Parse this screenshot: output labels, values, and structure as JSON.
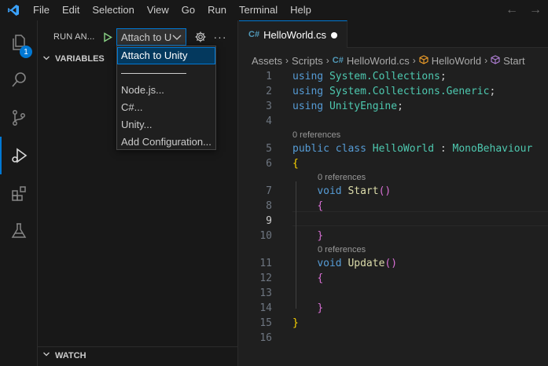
{
  "menu": {
    "items": [
      "File",
      "Edit",
      "Selection",
      "View",
      "Go",
      "Run",
      "Terminal",
      "Help"
    ]
  },
  "activity": {
    "explorer_badge": "1",
    "icons": [
      "files-icon",
      "search-icon",
      "source-control-icon",
      "run-debug-icon",
      "extensions-icon",
      "testing-icon"
    ]
  },
  "sidebar": {
    "run_label": "RUN AN...",
    "config_value": "Attach to Unity",
    "variables_label": "VARIABLES",
    "watch_label": "WATCH"
  },
  "dropdown": {
    "items": [
      "Attach to Unity",
      "Node.js...",
      "C#...",
      "Unity...",
      "Add Configuration..."
    ],
    "separator_text": "────────────"
  },
  "editor": {
    "tab_label": "HelloWorld.cs",
    "breadcrumbs": [
      "Assets",
      "Scripts",
      "HelloWorld.cs",
      "HelloWorld",
      "Start"
    ],
    "codelens": "0 references",
    "lines": [
      "using System.Collections;",
      "using System.Collections.Generic;",
      "using UnityEngine;",
      "",
      "public class HelloWorld : MonoBehaviour",
      "{",
      "    void Start()",
      "    {",
      "",
      "    }",
      "    void Update()",
      "    {",
      "",
      "    }",
      "}",
      ""
    ],
    "line_numbers": [
      "1",
      "2",
      "3",
      "4",
      "5",
      "6",
      "7",
      "8",
      "9",
      "10",
      "11",
      "12",
      "13",
      "14",
      "15",
      "16"
    ],
    "current_line": 9
  },
  "colors": {
    "accent": "#0078d4",
    "keyword": "#569cd6",
    "type": "#4ec9b0",
    "function": "#dcdcaa",
    "bracket_1": "#ffd700",
    "bracket_2": "#da70d6"
  }
}
